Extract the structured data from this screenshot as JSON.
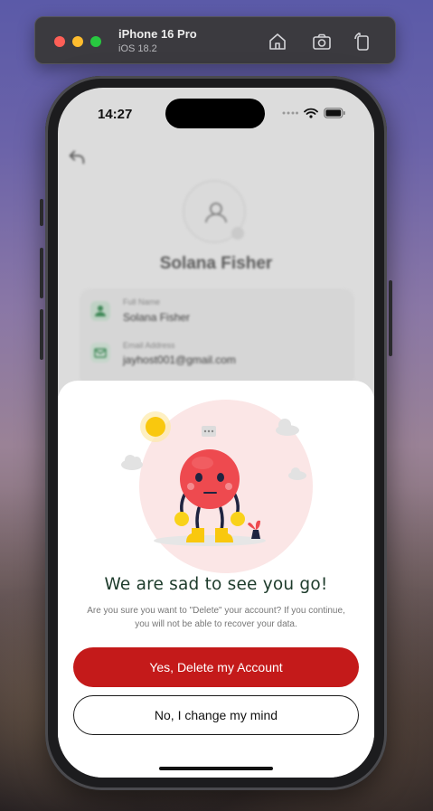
{
  "simulator": {
    "device_name": "iPhone 16 Pro",
    "os_version": "iOS 18.2",
    "icons": [
      "home-icon",
      "screenshot-icon",
      "rotate-icon"
    ]
  },
  "status_bar": {
    "time": "14:27",
    "icons": [
      "signal-dots-icon",
      "wifi-icon",
      "battery-icon"
    ]
  },
  "profile": {
    "name": "Solana Fisher",
    "fields": [
      {
        "label": "Full Name",
        "value": "Solana Fisher",
        "icon": "user-icon"
      },
      {
        "label": "Email Address",
        "value": "jayhost001@gmail.com",
        "icon": "mail-icon"
      }
    ]
  },
  "sheet": {
    "title": "We are sad to see you go!",
    "description": "Are you sure you want to \"Delete\" your account? If you continue, you will not be able to recover your data.",
    "confirm_label": "Yes, Delete my Account",
    "cancel_label": "No, I change my mind",
    "illustration": "sad-face-character"
  },
  "colors": {
    "danger": "#c41a1a",
    "title_green": "#1d3b2b",
    "illustration_bg": "#fbe6e6"
  }
}
